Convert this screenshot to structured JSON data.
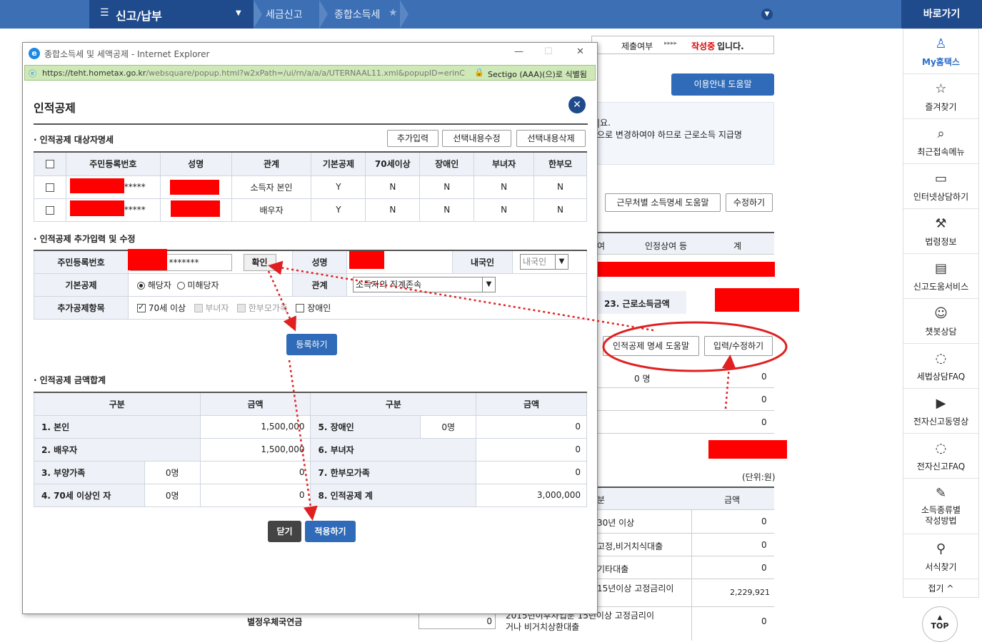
{
  "topnav": {
    "menu_label": "신고/납부",
    "crumbs": [
      "세금신고",
      "종합소득세"
    ],
    "star": "★"
  },
  "sidebar": {
    "title": "바로가기",
    "items": [
      {
        "label": "My홈택스",
        "icon": "user-icon"
      },
      {
        "label": "즐겨찾기",
        "icon": "star-icon"
      },
      {
        "label": "최근접속메뉴",
        "icon": "history-icon"
      },
      {
        "label": "인터넷상담하기",
        "icon": "monitor-icon"
      },
      {
        "label": "법령정보",
        "icon": "gavel-icon"
      },
      {
        "label": "신고도움서비스",
        "icon": "book-icon"
      },
      {
        "label": "챗봇상담",
        "icon": "chatbot-icon"
      },
      {
        "label": "세법상담FAQ",
        "icon": "faq-icon"
      },
      {
        "label": "전자신고동영상",
        "icon": "video-icon"
      },
      {
        "label": "전자신고FAQ",
        "icon": "faq-icon"
      },
      {
        "label": "소득종류별\n작성방법",
        "icon": "edit-icon"
      },
      {
        "label": "서식찾기",
        "icon": "search-icon"
      }
    ],
    "collapse": "접기 ^",
    "top": "TOP"
  },
  "background": {
    "status_label": "제출여부",
    "status_arrows": "▸▸▸▸",
    "status_value": "작성중",
    "status_suffix": "입니다.",
    "guide_button": "이용안내 도움말",
    "notice_1": "|요.",
    "notice_2": "으로 변경하여야 하므로 근로소득 지급명",
    "workplace_help": "근무처별 소득명세 도움말",
    "modify": "수정하기",
    "col_yeo": "여",
    "col_injeong": "인정상여 등",
    "col_gye": "계",
    "wage_label": "23. 근로소득금액",
    "deduction_help": "인적공제 명세 도움말",
    "input_modify": "입력/수정하기",
    "zero_persons": "0 명",
    "zeros": [
      "0",
      "0",
      "0",
      "0"
    ],
    "unit": "(단위:원)",
    "col_bun": "분",
    "col_amount": "금액",
    "loan_rows": [
      {
        "label": "30년 이상",
        "amount": "0"
      },
      {
        "label": "고정,비거치식대출",
        "amount": "0"
      },
      {
        "label": "기타대출",
        "amount": "0"
      },
      {
        "label": "15년이상 고정금리이",
        "amount": "2,229,921"
      },
      {
        "label": "2015년이후차입분 15년이상 고정금리이\n거나 비거치상환대출",
        "amount": "0"
      }
    ],
    "pension_label": "별정우체국연금",
    "pension_value": "0"
  },
  "popup": {
    "window_title": "종합소득세 및 세액공제 - Internet Explorer",
    "url_prefix": "https://",
    "url_host": "teht.hometax.go.kr",
    "url_path": "/websquare/popup.html?w2xPath=/ui/rn/a/a/a/UTERNAAL11.xml&popupID=erinC",
    "cert": "Sectigo (AAA)(으)로 식별됨",
    "heading": "인적공제",
    "section1": "인적공제 대상자명세",
    "buttons": {
      "add": "추가입력",
      "edit": "선택내용수정",
      "delete": "선택내용삭제"
    },
    "table_headers": [
      "주민등록번호",
      "성명",
      "관계",
      "기본공제",
      "70세이상",
      "장애인",
      "부녀자",
      "한부모"
    ],
    "rows": [
      {
        "rrn_suffix": "*****",
        "relation": "소득자 본인",
        "basic": "Y",
        "over70": "N",
        "disabled": "N",
        "woman": "N",
        "single": "N"
      },
      {
        "rrn_suffix": "*****",
        "relation": "배우자",
        "basic": "Y",
        "over70": "N",
        "disabled": "N",
        "woman": "N",
        "single": "N"
      }
    ],
    "section2": "인적공제 추가입력 및 수정",
    "form": {
      "rrn_label": "주민등록번호",
      "rrn_value": "*******",
      "confirm": "확인",
      "name_label": "성명",
      "nationality_label": "내국인",
      "nationality_value": "내국인",
      "basic_label": "기본공제",
      "radio_yes": "해당자",
      "radio_no": "미해당자",
      "relation_label": "관계",
      "relation_value": "소득자의 직계존속",
      "extra_label": "추가공제항목",
      "chk_over70": "70세 이상",
      "chk_woman": "부녀자",
      "chk_single": "한부모가족",
      "chk_disabled": "장애인"
    },
    "register": "등록하기",
    "section3": "인적공제 금액합계",
    "sum_headers": {
      "gubun": "구분",
      "amount": "금액"
    },
    "sum_rows": [
      {
        "l_label": "1. 본인",
        "l_count": "",
        "l_amount": "1,500,000",
        "r_label": "5. 장애인",
        "r_count": "0명",
        "r_amount": "0"
      },
      {
        "l_label": "2. 배우자",
        "l_count": "",
        "l_amount": "1,500,000",
        "r_label": "6. 부녀자",
        "r_count": "",
        "r_amount": "0"
      },
      {
        "l_label": "3. 부양가족",
        "l_count": "0명",
        "l_amount": "0",
        "r_label": "7. 한부모가족",
        "r_count": "",
        "r_amount": "0"
      },
      {
        "l_label": "4. 70세 이상인 자",
        "l_count": "0명",
        "l_amount": "0",
        "r_label": "8. 인적공제 계",
        "r_count": "",
        "r_amount": "3,000,000"
      }
    ],
    "close": "닫기",
    "apply": "적용하기"
  },
  "colors": {
    "nav": "#3c6fb4",
    "nav_dark": "#1f4a8c",
    "button_blue": "#2f6bb8",
    "annotation_red": "#e02020"
  }
}
